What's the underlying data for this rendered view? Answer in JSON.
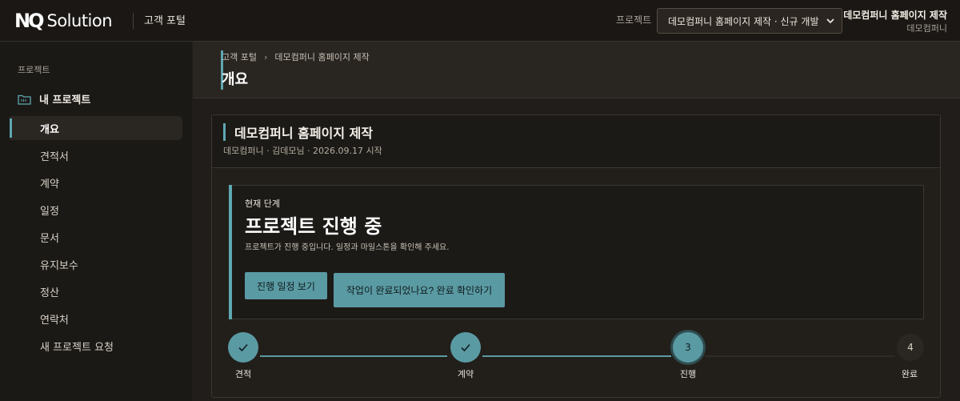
{
  "header": {
    "logo_mark": "NQ",
    "logo_text": "Solution",
    "portal_title": "고객 포털",
    "project_label": "프로젝트",
    "project_selected": "데모컴퍼니 홈페이지 제작 · 신규 개발",
    "user_name": "데모컴퍼니 홈페이지 제작",
    "user_company": "데모컴퍼니"
  },
  "sidebar": {
    "section_label": "프로젝트",
    "group_label": "내 프로젝트",
    "items": [
      {
        "label": "개요",
        "active": true
      },
      {
        "label": "견적서"
      },
      {
        "label": "계약"
      },
      {
        "label": "일정"
      },
      {
        "label": "문서"
      },
      {
        "label": "유지보수"
      },
      {
        "label": "정산"
      },
      {
        "label": "연락처"
      },
      {
        "label": "새 프로젝트 요청"
      }
    ]
  },
  "page": {
    "breadcrumb": [
      "고객 포털",
      "데모컴퍼니 홈페이지 제작"
    ],
    "breadcrumb_sep": "›",
    "title": "개요"
  },
  "project": {
    "title": "데모컴퍼니 홈페이지 제작",
    "meta": "데모컴퍼니 · 김데모님 · 2026.09.17 시작"
  },
  "stage": {
    "label": "현재 단계",
    "title": "프로젝트 진행 중",
    "description": "프로젝트가 진행 중입니다. 일정과 마일스톤을 확인해 주세요.",
    "schedule_button": "진행 일정 보기",
    "complete_button": "작업이 완료되었나요? 완료 확인하기"
  },
  "steps": [
    {
      "number": "1",
      "label": "견적",
      "status": "done"
    },
    {
      "number": "2",
      "label": "계약",
      "status": "done"
    },
    {
      "number": "3",
      "label": "진행",
      "status": "current"
    },
    {
      "number": "4",
      "label": "완료",
      "status": "todo"
    }
  ],
  "colors": {
    "accent": "#5fa7b1",
    "button": "#5a9aa3",
    "background": "#201d1a"
  }
}
